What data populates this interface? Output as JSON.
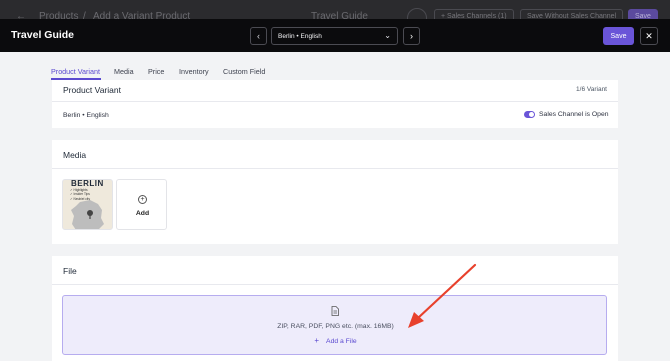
{
  "background_bar": {
    "back_arrow": "←",
    "breadcrumb_1": "Products",
    "breadcrumb_sep": "/",
    "breadcrumb_2": "Add a Variant Product",
    "center_title": "Travel Guide",
    "sales_channels_label": "+ Sales Channels (1)",
    "save_without_label": "Save Without Sales Channel",
    "save_label": "Save"
  },
  "modal": {
    "title": "Travel Guide",
    "prev_icon": "‹",
    "next_icon": "›",
    "language_value": "Berlin • English",
    "chevron": "⌄",
    "save_label": "Save",
    "close_icon": "✕"
  },
  "tabs": [
    "Product Variant",
    "Media",
    "Price",
    "Inventory",
    "Custom Field"
  ],
  "variant_card": {
    "title": "Product Variant",
    "count": "1/6 Variant",
    "variant_name": "Berlin • English",
    "toggle_label": "Sales Channel is Open",
    "toggle_on": true
  },
  "media_card": {
    "title": "Media",
    "thumbnail_heading": "BERLIN",
    "thumbnail_items": [
      "✓ Highlights",
      "✓ Insider Tips",
      "✓ Neubiel city"
    ],
    "add_label": "Add"
  },
  "file_card": {
    "title": "File",
    "hint": "ZIP, RAR, PDF, PNG etc. (max. 16MB)",
    "add_file_label": "Add a File",
    "plus": "+"
  },
  "colors": {
    "accent": "#6a55d8",
    "annotation_arrow": "#e8412c"
  }
}
